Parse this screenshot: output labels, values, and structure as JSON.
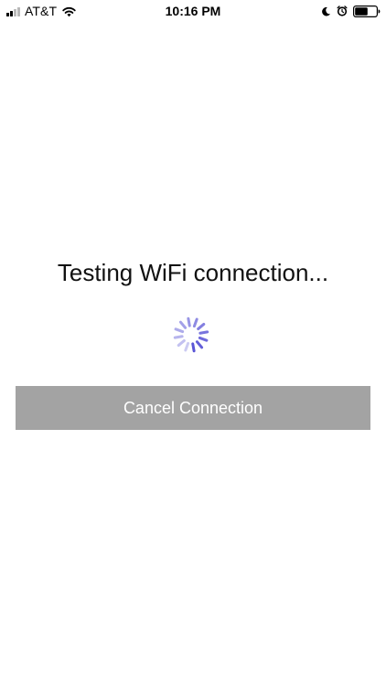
{
  "status_bar": {
    "carrier": "AT&T",
    "time": "10:16 PM",
    "signal_bars_filled": 2,
    "signal_bars_total": 4,
    "battery_level": 0.6,
    "icons": {
      "signal": "signal-strength-icon",
      "wifi": "wifi-icon",
      "moon": "do-not-disturb-moon-icon",
      "alarm": "alarm-clock-icon",
      "battery": "battery-icon"
    }
  },
  "main": {
    "title": "Testing WiFi connection...",
    "spinner_icon": "loading-spinner-icon",
    "cancel_button_label": "Cancel Connection"
  },
  "colors": {
    "spinner": "#5a55d6",
    "button_background": "#a3a3a3",
    "button_text": "#ffffff"
  }
}
